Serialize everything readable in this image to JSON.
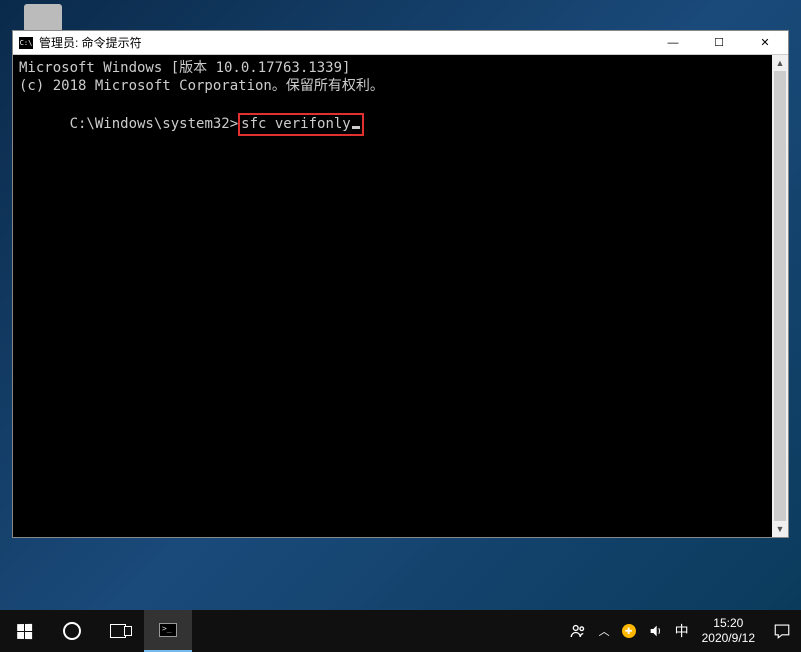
{
  "desktop": {},
  "cmd_window": {
    "title": "管理员: 命令提示符",
    "controls": {
      "minimize": "—",
      "maximize": "☐",
      "close": "✕"
    },
    "lines": {
      "l1": "Microsoft Windows [版本 10.0.17763.1339]",
      "l2": "(c) 2018 Microsoft Corporation。保留所有权利。",
      "blank": "",
      "prompt": "C:\\Windows\\system32>",
      "command": "sfc verifonly"
    }
  },
  "taskbar": {
    "ime": "中",
    "time": "15:20",
    "date": "2020/9/12"
  }
}
